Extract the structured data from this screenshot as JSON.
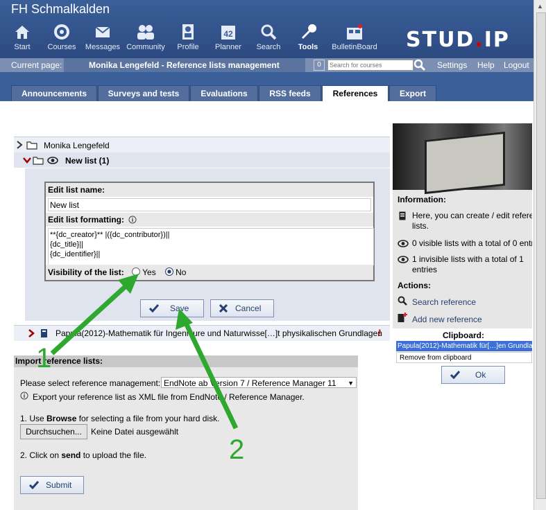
{
  "header": {
    "site_title": "FH Schmalkalden",
    "logo": "STUD.IP",
    "nav": [
      {
        "label": "Start",
        "icon": "home-icon"
      },
      {
        "label": "Courses",
        "icon": "courses-icon"
      },
      {
        "label": "Messages",
        "icon": "envelope-icon"
      },
      {
        "label": "Community",
        "icon": "community-icon"
      },
      {
        "label": "Profile",
        "icon": "profile-icon"
      },
      {
        "label": "Planner",
        "icon": "calendar-icon"
      },
      {
        "label": "Search",
        "icon": "search-icon"
      },
      {
        "label": "Tools",
        "icon": "wrench-icon"
      },
      {
        "label": "BulletinBoard",
        "icon": "bulletin-icon"
      }
    ]
  },
  "breadcrumb": {
    "prefix": "Current page:",
    "title": "Monika Lengefeld - Reference lists management",
    "badge": "0",
    "search_placeholder": "Search for courses",
    "links": [
      "Settings",
      "Help",
      "Logout"
    ]
  },
  "tabs": [
    "Announcements",
    "Surveys and tests",
    "Evaluations",
    "RSS feeds",
    "References",
    "Export"
  ],
  "tree": {
    "owner": "Monika Lengefeld",
    "list_name": "New list (1)",
    "entry": "Papula(2012)-Mathematik für Ingenieure und Naturwisse[…]t physikalischen Grundlagen"
  },
  "edit": {
    "name_label": "Edit list name:",
    "name_value": "New list",
    "format_label": "Edit list formatting:",
    "format_lines": [
      "**{dc_creator}** |({dc_contributor})||",
      "{dc_title}||",
      "{dc_identifier}||"
    ],
    "visibility_label": "Visibility of the list:",
    "yes": "Yes",
    "no": "No",
    "save": "Save",
    "cancel": "Cancel"
  },
  "sidebar": {
    "info_heading": "Information:",
    "info_text": "Here, you can create / edit refere lists.",
    "visible_lists": "0 visible lists with a total of 0 entri",
    "invisible_lists": "1 invisible lists with a total of 1 entries",
    "actions_heading": "Actions:",
    "search_reference": "Search reference",
    "add_reference": "Add new reference",
    "clipboard_heading": "Clipboard:",
    "clipboard_item": "Papula(2012)-Mathematik für[…]en Grundlage",
    "remove": "Remove from clipboard",
    "ok": "Ok"
  },
  "import": {
    "heading": "Import reference lists:",
    "select_label": "Please select reference management:",
    "select_value": "EndNote ab Version 7 / Reference Manager 11",
    "hint": "Export your reference list as XML file from EndNote / Reference Manager.",
    "step1_a": "1. Use ",
    "step1_b": "Browse",
    "step1_c": " for selecting a file from your hard disk.",
    "browse_button": "Durchsuchen...",
    "no_file": "Keine Datei ausgewählt",
    "step2_a": "2. Click on ",
    "step2_b": "send",
    "step2_c": " to upload the file.",
    "submit": "Submit"
  },
  "annotations": {
    "one": "1",
    "two": "2",
    "color": "#2fa82f"
  }
}
